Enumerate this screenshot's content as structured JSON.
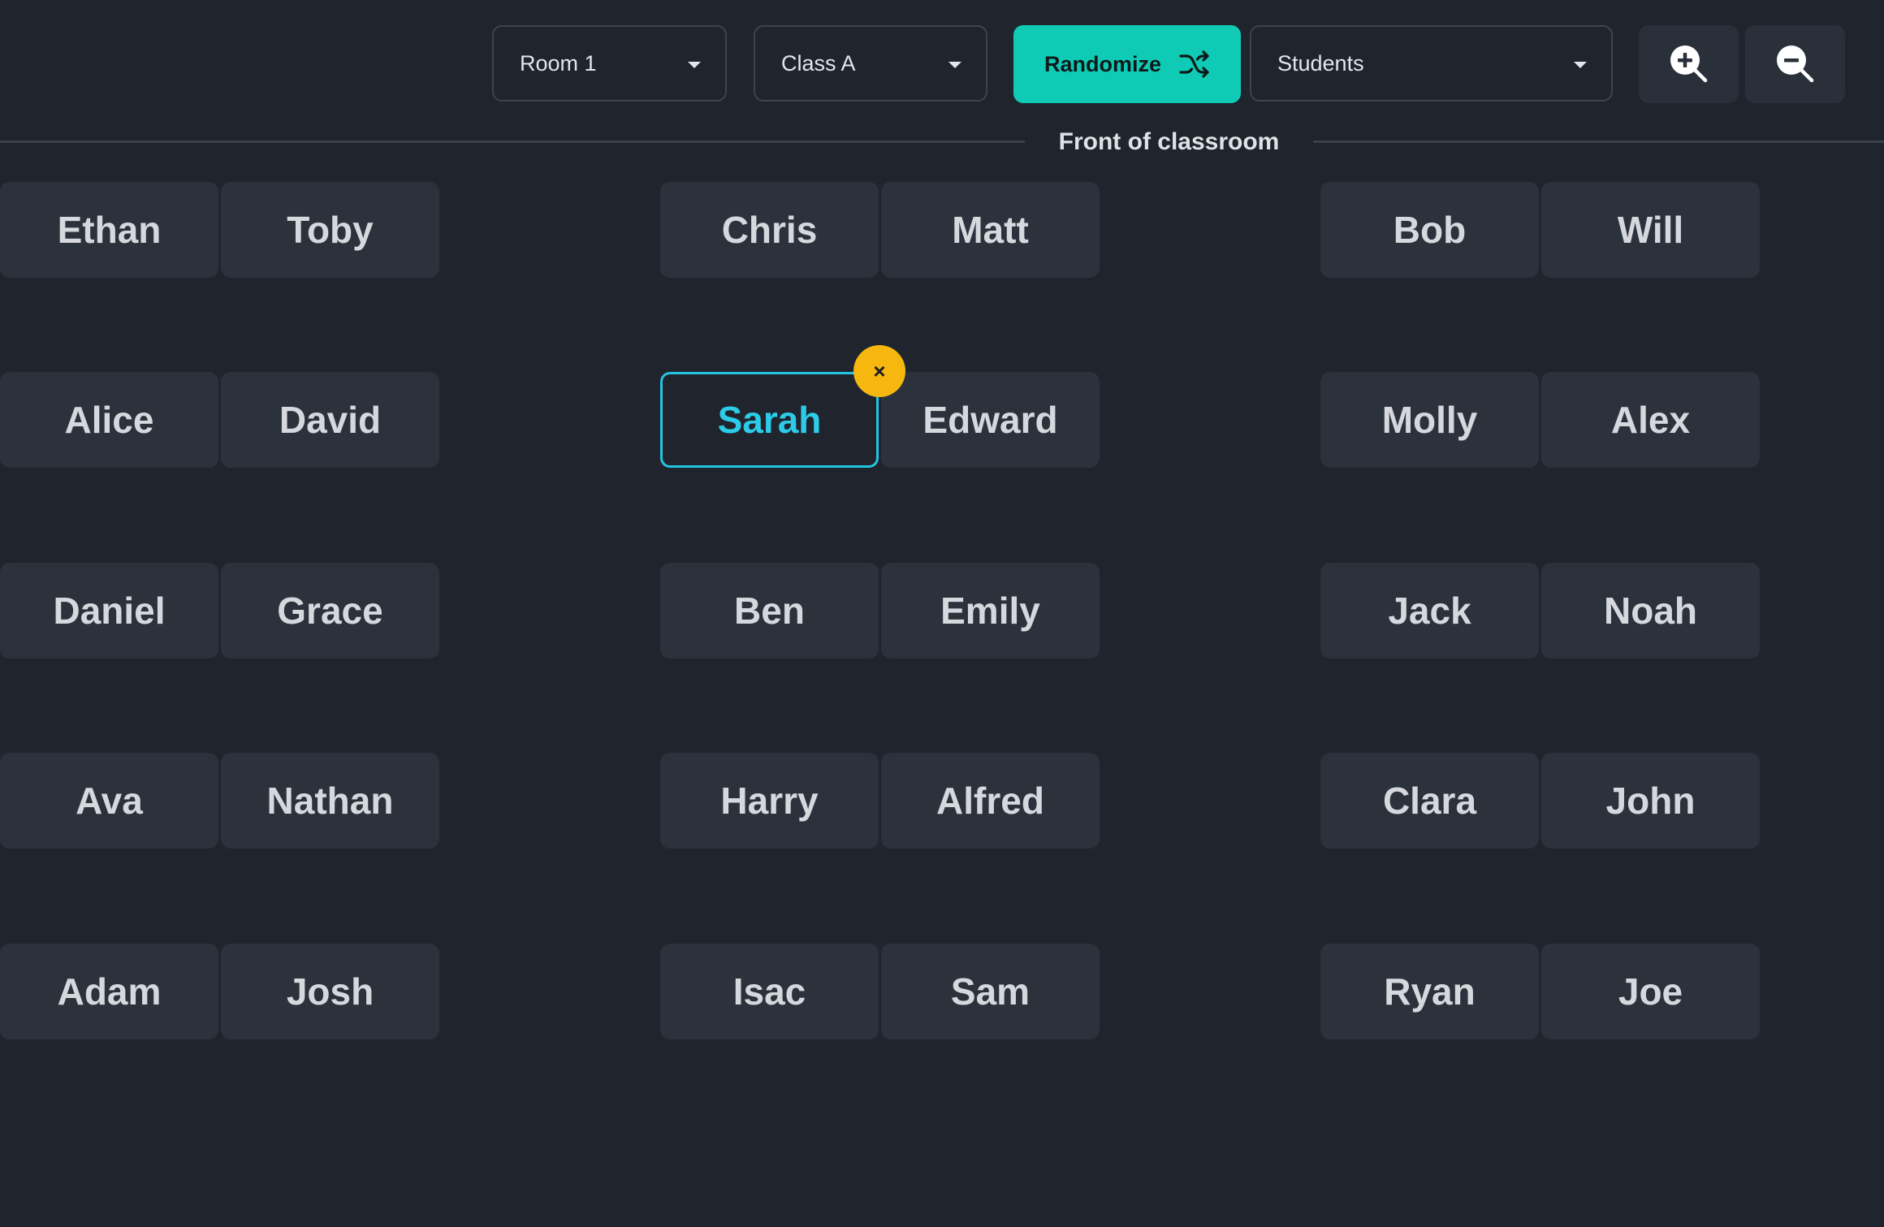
{
  "toolbar": {
    "room": {
      "value": "Room 1"
    },
    "class": {
      "value": "Class A"
    },
    "randomize": {
      "label": "Randomize",
      "icon": "shuffle-icon"
    },
    "students": {
      "value": "Students"
    },
    "zoom_in": {
      "icon": "zoom-in-icon"
    },
    "zoom_out": {
      "icon": "zoom-out-icon"
    }
  },
  "front_label": "Front of classroom",
  "colors": {
    "background": "#1f242d",
    "seat": "#2c323c",
    "accent": "#0fcbb6",
    "selected": "#22c4e0",
    "remove_badge": "#f6b80f"
  },
  "remove_badge": {
    "icon": "close-icon",
    "glyph": "×"
  },
  "rows": [
    {
      "desks": [
        [
          "Ethan",
          "Toby"
        ],
        [
          "Chris",
          "Matt"
        ],
        [
          "Bob",
          "Will"
        ]
      ]
    },
    {
      "desks": [
        [
          "Alice",
          "David"
        ],
        [
          "Sarah",
          "Edward"
        ],
        [
          "Molly",
          "Alex"
        ]
      ]
    },
    {
      "desks": [
        [
          "Daniel",
          "Grace"
        ],
        [
          "Ben",
          "Emily"
        ],
        [
          "Jack",
          "Noah"
        ]
      ]
    },
    {
      "desks": [
        [
          "Ava",
          "Nathan"
        ],
        [
          "Harry",
          "Alfred"
        ],
        [
          "Clara",
          "John"
        ]
      ]
    },
    {
      "desks": [
        [
          "Adam",
          "Josh"
        ],
        [
          "Isac",
          "Sam"
        ],
        [
          "Ryan",
          "Joe"
        ]
      ]
    }
  ],
  "selected_student": "Sarah"
}
